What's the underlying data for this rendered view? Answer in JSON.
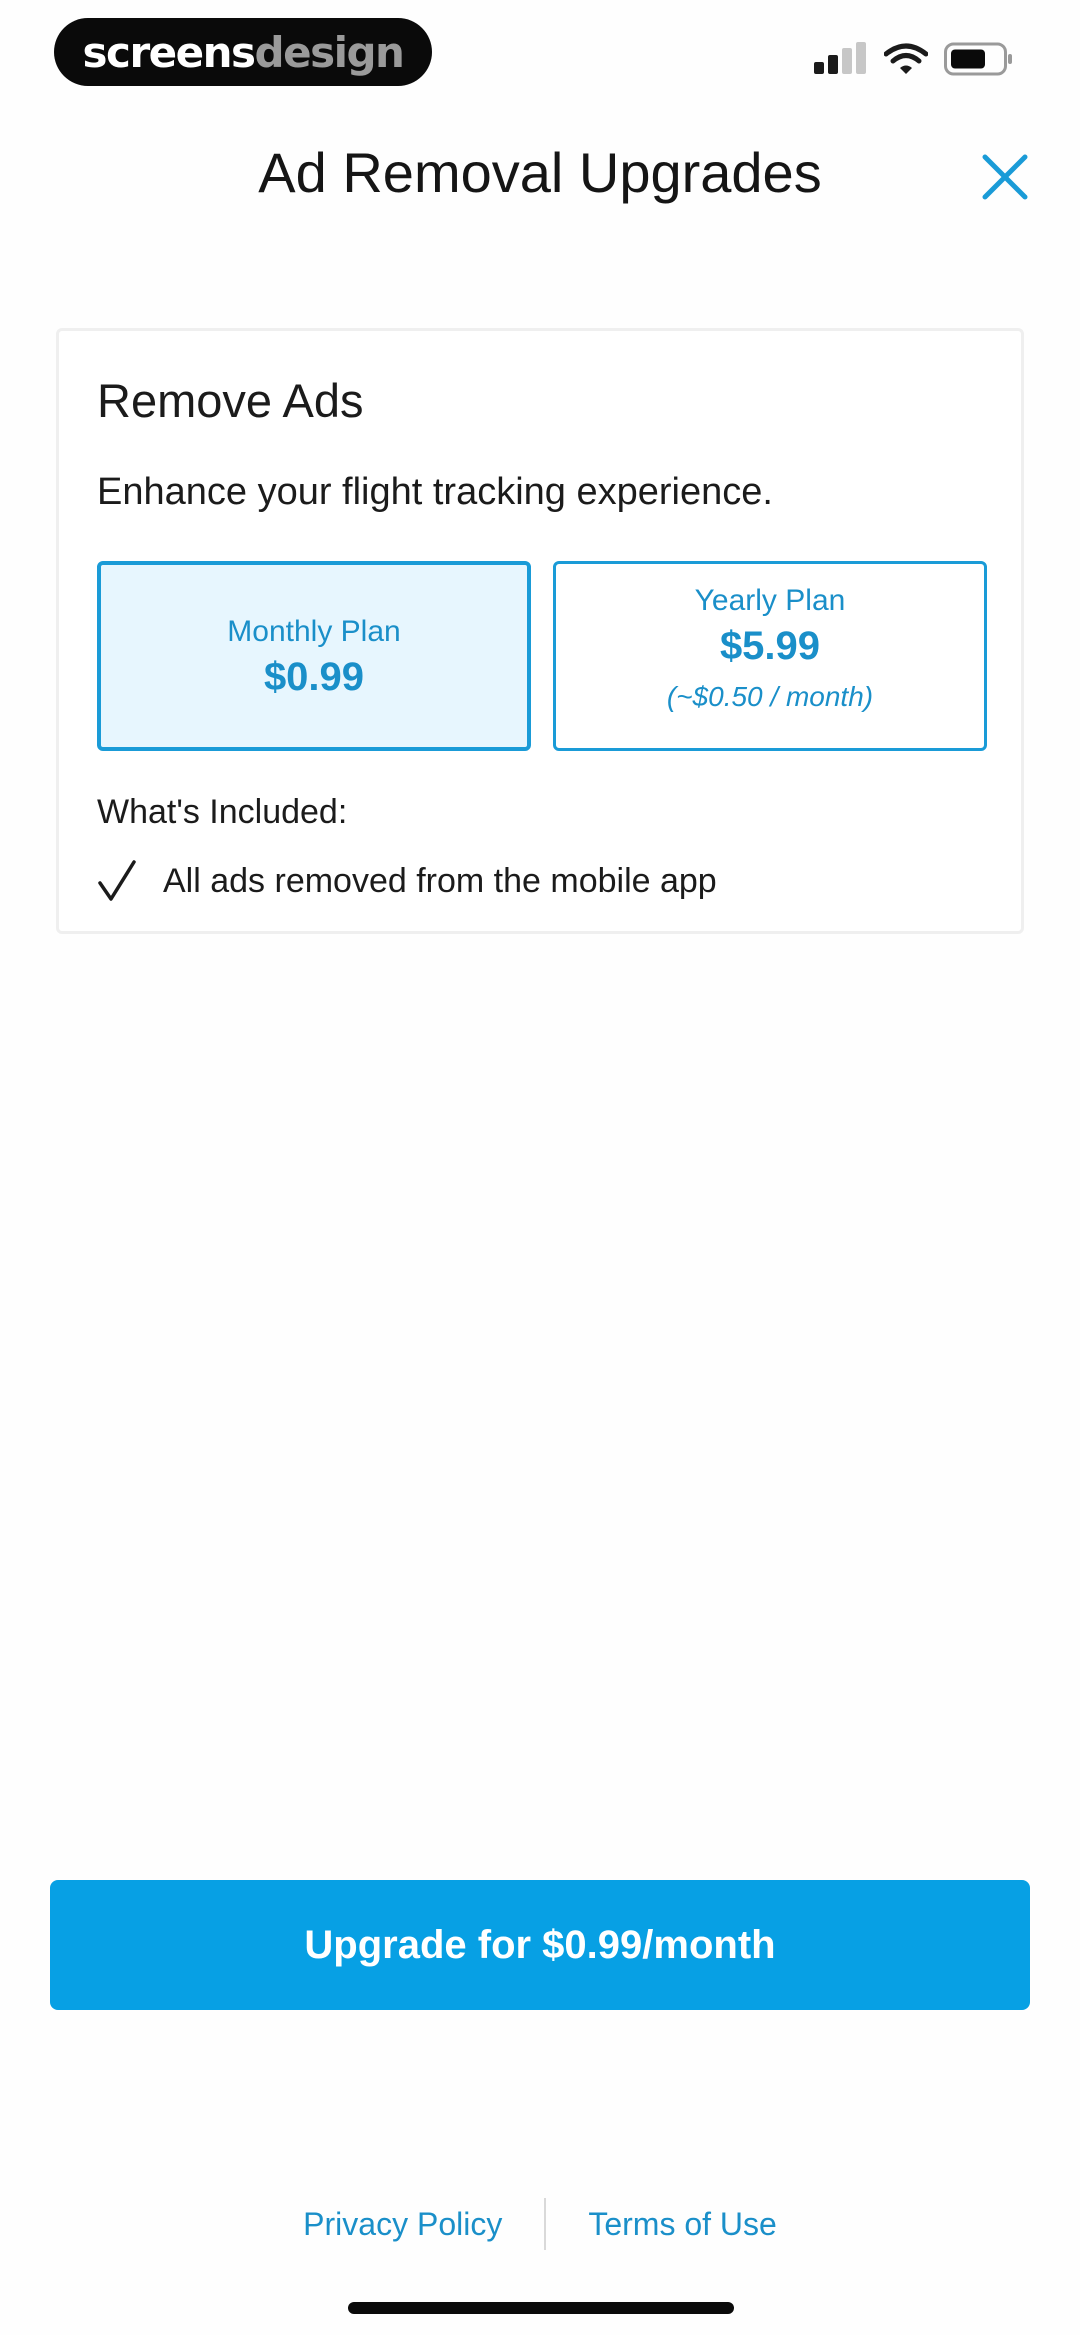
{
  "status_bar": {
    "brand_part_a": "screens",
    "brand_part_b": "design",
    "icons": [
      "cellular-signal-icon",
      "wifi-icon",
      "battery-icon"
    ]
  },
  "header": {
    "title": "Ad Removal Upgrades",
    "close_icon": "close-icon"
  },
  "card": {
    "title": "Remove Ads",
    "subtitle": "Enhance your flight tracking experience.",
    "plans": [
      {
        "name": "Monthly Plan",
        "price": "$0.99",
        "note": "",
        "selected": true
      },
      {
        "name": "Yearly Plan",
        "price": "$5.99",
        "note": "(~$0.50 / month)",
        "selected": false
      }
    ],
    "included_title": "What's Included:",
    "included_items": [
      "All ads removed from the mobile app"
    ]
  },
  "upgrade_button": {
    "label": "Upgrade for $0.99/month"
  },
  "footer": {
    "privacy_label": "Privacy Policy",
    "terms_label": "Terms of Use"
  },
  "colors": {
    "accent": "#07a0e4",
    "accent_text": "#1a8fc9",
    "selected_plan_bg": "#e7f6fe"
  }
}
